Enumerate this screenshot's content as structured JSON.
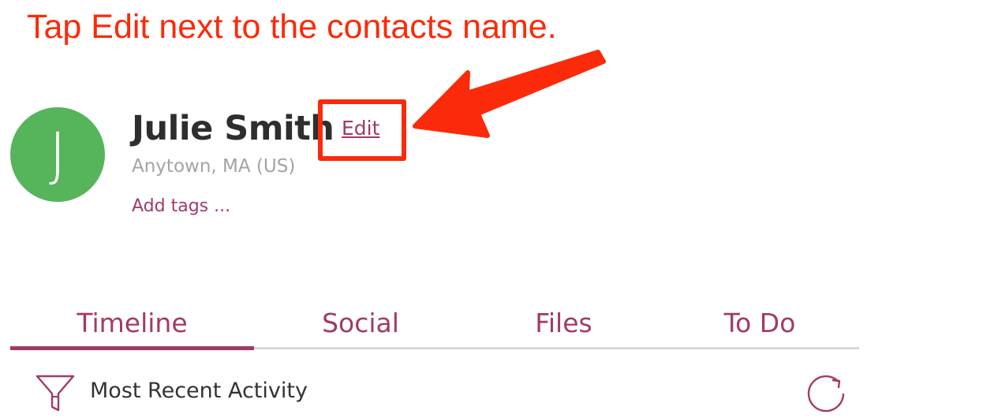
{
  "annotation": {
    "text": "Tap Edit next to the contacts name."
  },
  "contact": {
    "avatar_initial": "J",
    "name": "Julie Smith",
    "edit_label": "Edit",
    "location": "Anytown, MA (US)",
    "add_tags_label": "Add tags ..."
  },
  "tabs": [
    {
      "label": "Timeline",
      "active": true
    },
    {
      "label": "Social",
      "active": false
    },
    {
      "label": "Files",
      "active": false
    },
    {
      "label": "To Do",
      "active": false
    }
  ],
  "activity": {
    "filter_icon": "filter-funnel-icon",
    "label": "Most Recent Activity",
    "refresh_icon": "refresh-icon"
  },
  "colors": {
    "annotation_red": "#fb2a0a",
    "accent_plum": "#a13a68",
    "avatar_green": "#56b45b",
    "name_text": "#2e2e2e",
    "muted_text": "#a3a3a3"
  }
}
